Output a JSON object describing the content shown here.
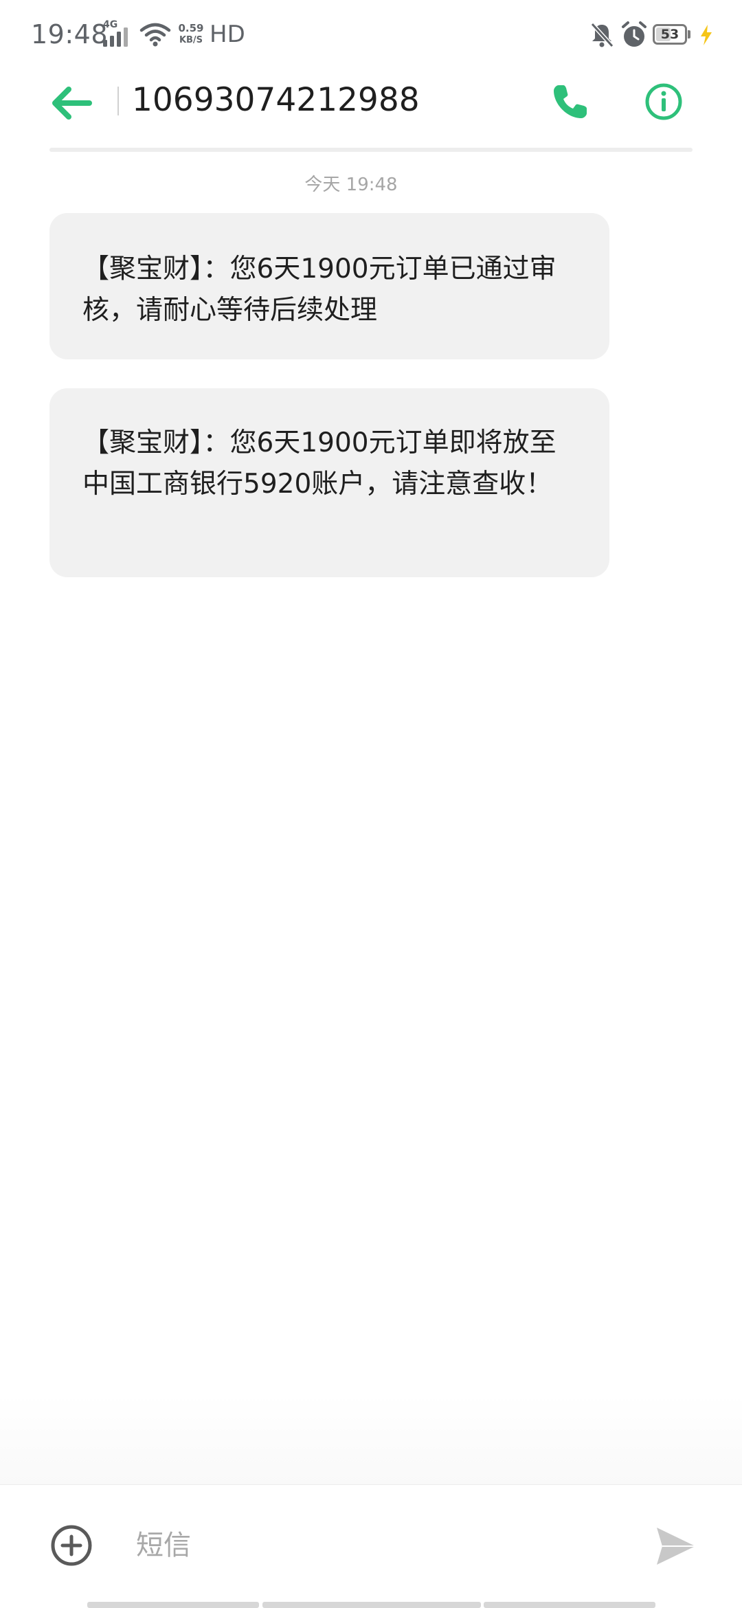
{
  "status_bar": {
    "time": "19:48",
    "network_type": "4G",
    "speed_value": "0.59",
    "speed_unit": "KB/S",
    "hd_label": "HD",
    "battery_level": "53",
    "icons": [
      "signal-icon",
      "wifi-icon",
      "mute-icon",
      "alarm-icon",
      "battery-icon",
      "charging-icon"
    ]
  },
  "header": {
    "contact_number": "10693074212988",
    "icons": [
      "back-arrow-icon",
      "phone-icon",
      "info-icon"
    ],
    "accent_color": "#2ec07a"
  },
  "conversation": {
    "timestamp": "今天 19:48",
    "messages": [
      {
        "text": "【聚宝财】：您6天1900元订单已通过审核，请耐心等待后续处理"
      },
      {
        "text": "【聚宝财】：您6天1900元订单即将放至中国工商银行5920账户，请注意查收！"
      }
    ]
  },
  "compose": {
    "placeholder": "短信",
    "value": "",
    "icons": [
      "add-icon",
      "send-icon"
    ]
  }
}
